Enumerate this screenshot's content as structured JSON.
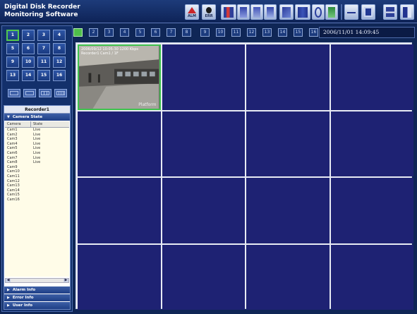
{
  "header": {
    "title_line1": "Digital Disk Recorder",
    "title_line2": "Monitoring Software",
    "alm_label": "ALM",
    "err_label": "ERR"
  },
  "channel_buttons": [
    "1",
    "2",
    "3",
    "4",
    "5",
    "6",
    "7",
    "8",
    "9",
    "10",
    "11",
    "12",
    "13",
    "14",
    "15",
    "16"
  ],
  "selected_channel": "1",
  "recorder": {
    "title": "Recorder1",
    "camera_state_label": "Camera State",
    "col_camera": "Camera",
    "col_state": "State",
    "rows": [
      {
        "camera": "Cam1",
        "state": "Live"
      },
      {
        "camera": "Cam2",
        "state": "Live"
      },
      {
        "camera": "Cam3",
        "state": "Live"
      },
      {
        "camera": "Cam4",
        "state": "Live"
      },
      {
        "camera": "Cam5",
        "state": "Live"
      },
      {
        "camera": "Cam6",
        "state": "Live"
      },
      {
        "camera": "Cam7",
        "state": "Live"
      },
      {
        "camera": "Cam8",
        "state": "Live"
      },
      {
        "camera": "Cam9",
        "state": ""
      },
      {
        "camera": "Cam10",
        "state": ""
      },
      {
        "camera": "Cam11",
        "state": ""
      },
      {
        "camera": "Cam12",
        "state": ""
      },
      {
        "camera": "Cam13",
        "state": ""
      },
      {
        "camera": "Cam14",
        "state": ""
      },
      {
        "camera": "Cam15",
        "state": ""
      },
      {
        "camera": "Cam16",
        "state": ""
      }
    ],
    "alarm_info_label": "Alarm Info",
    "error_info_label": "Error Info",
    "user_info_label": "User Info"
  },
  "camera_strip": [
    "1",
    "2",
    "3",
    "4",
    "5",
    "6",
    "7",
    "8",
    "9",
    "10",
    "11",
    "12",
    "13",
    "14",
    "15",
    "16"
  ],
  "active_strip_index": 0,
  "datetime": "2006/11/01  14:09:45",
  "live_cell": {
    "osd_line1": "2006/09/12 10:05:30 1200 Kbps",
    "osd_line2": "Recorder1 Cam1 / 1F",
    "label": "Platform"
  },
  "colors": {
    "background": "#0f2656",
    "cell": "#1e2273",
    "active_green": "#3fc24d"
  }
}
